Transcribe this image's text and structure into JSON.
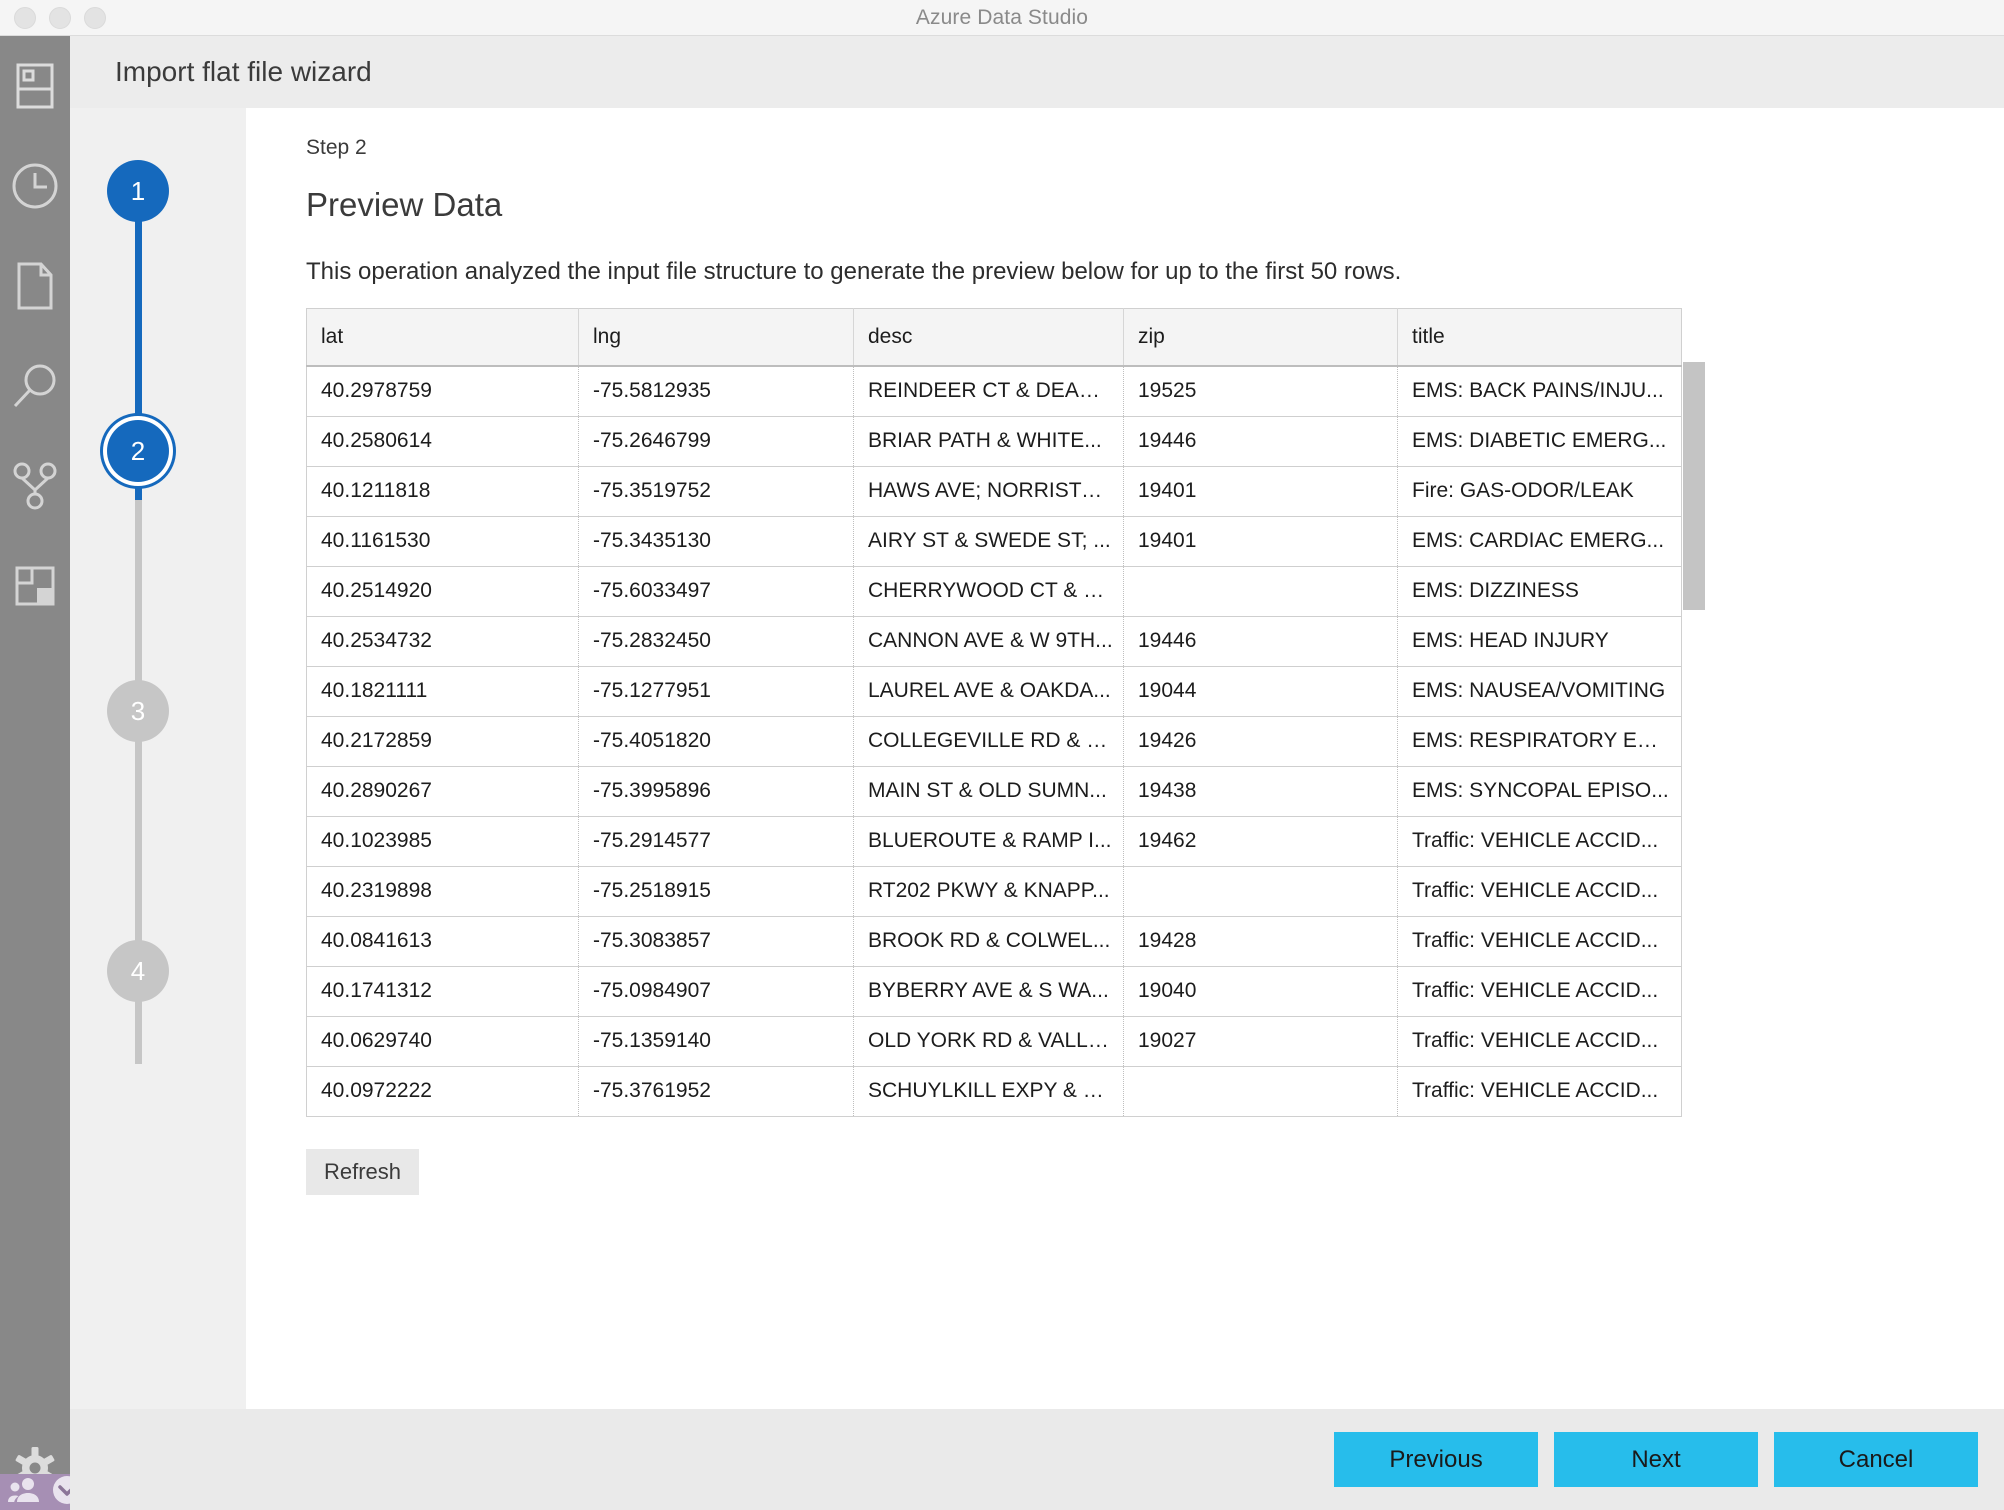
{
  "window": {
    "title": "Azure Data Studio",
    "traffic_lights": [
      "close",
      "minimize",
      "zoom"
    ]
  },
  "activity_bar": {
    "icons": [
      {
        "name": "servers-icon",
        "label": "Servers"
      },
      {
        "name": "history-clock-icon",
        "label": "History"
      },
      {
        "name": "file-page-icon",
        "label": "Notebooks"
      },
      {
        "name": "search-magnifier-icon",
        "label": "Search"
      },
      {
        "name": "source-control-branch-icon",
        "label": "Source Control"
      },
      {
        "name": "extensions-box-icon",
        "label": "Extensions"
      }
    ],
    "bottom_icons": [
      {
        "name": "gear-settings-icon",
        "label": "Manage"
      }
    ],
    "status_icons": [
      {
        "name": "accounts-people-icon",
        "label": "Accounts"
      },
      {
        "name": "circle-chevron-icon",
        "label": "Notifications"
      }
    ]
  },
  "wizard": {
    "header_title": "Import flat file wizard",
    "steps": [
      {
        "number": "1",
        "state": "done"
      },
      {
        "number": "2",
        "state": "current"
      },
      {
        "number": "3",
        "state": "todo"
      },
      {
        "number": "4",
        "state": "todo"
      }
    ],
    "eyebrow": "Step 2",
    "heading": "Preview Data",
    "description": "This operation analyzed the input file structure to generate the preview below for up to the first 50 rows.",
    "refresh_label": "Refresh"
  },
  "preview_table": {
    "columns": [
      "lat",
      "lng",
      "desc",
      "zip",
      "title"
    ],
    "rows": [
      [
        "40.2978759",
        "-75.5812935",
        "REINDEER CT & DEAD ...",
        "19525",
        "EMS: BACK PAINS/INJU..."
      ],
      [
        "40.2580614",
        "-75.2646799",
        "BRIAR PATH & WHITE...",
        "19446",
        "EMS: DIABETIC EMERG..."
      ],
      [
        "40.1211818",
        "-75.3519752",
        "HAWS AVE; NORRISTO...",
        "19401",
        "Fire: GAS-ODOR/LEAK"
      ],
      [
        "40.1161530",
        "-75.3435130",
        "AIRY ST & SWEDE ST; ...",
        "19401",
        "EMS: CARDIAC EMERG..."
      ],
      [
        "40.2514920",
        "-75.6033497",
        "CHERRYWOOD CT & D...",
        "",
        "EMS: DIZZINESS"
      ],
      [
        "40.2534732",
        "-75.2832450",
        "CANNON AVE & W 9TH...",
        "19446",
        "EMS: HEAD INJURY"
      ],
      [
        "40.1821111",
        "-75.1277951",
        "LAUREL AVE & OAKDA...",
        "19044",
        "EMS: NAUSEA/VOMITING"
      ],
      [
        "40.2172859",
        "-75.4051820",
        "COLLEGEVILLE RD & L...",
        "19426",
        "EMS: RESPIRATORY EM..."
      ],
      [
        "40.2890267",
        "-75.3995896",
        "MAIN ST & OLD SUMN...",
        "19438",
        "EMS: SYNCOPAL EPISO..."
      ],
      [
        "40.1023985",
        "-75.2914577",
        "BLUEROUTE & RAMP I...",
        "19462",
        "Traffic: VEHICLE ACCID..."
      ],
      [
        "40.2319898",
        "-75.2518915",
        "RT202 PKWY & KNAPP...",
        "",
        "Traffic: VEHICLE ACCID..."
      ],
      [
        "40.0841613",
        "-75.3083857",
        "BROOK RD & COLWEL...",
        "19428",
        "Traffic: VEHICLE ACCID..."
      ],
      [
        "40.1741312",
        "-75.0984907",
        "BYBERRY AVE & S WA...",
        "19040",
        "Traffic: VEHICLE ACCID..."
      ],
      [
        "40.0629740",
        "-75.1359140",
        "OLD YORK RD & VALLE...",
        "19027",
        "Traffic: VEHICLE ACCID..."
      ],
      [
        "40.0972222",
        "-75.3761952",
        "SCHUYLKILL EXPY & C...",
        "",
        "Traffic: VEHICLE ACCID..."
      ]
    ]
  },
  "footer": {
    "previous_label": "Previous",
    "next_label": "Next",
    "cancel_label": "Cancel"
  },
  "colors": {
    "accent_blue": "#1569bd",
    "button_cyan": "#27bdeb",
    "activity_bar": "#888888",
    "status_bar_purple": "#a68fb4",
    "step_inactive": "#c6c6c6"
  }
}
